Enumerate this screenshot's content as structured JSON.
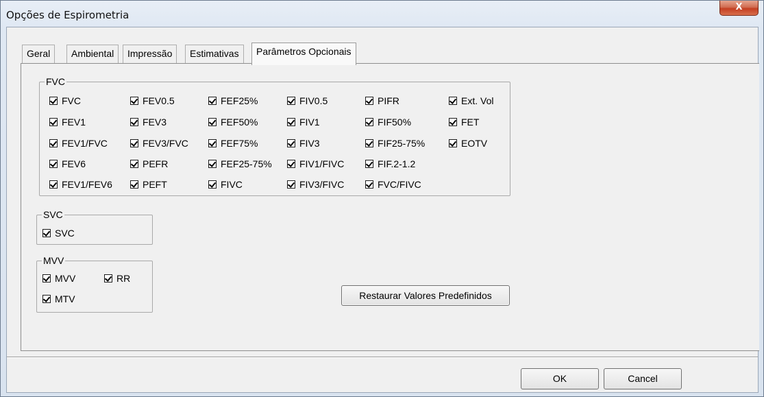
{
  "window": {
    "title": "Opções de Espirometria",
    "close_glyph": "X"
  },
  "tabs": [
    {
      "label": "Geral"
    },
    {
      "label": "Ambiental"
    },
    {
      "label": "Impressão"
    },
    {
      "label": "Estimativas"
    },
    {
      "label": "Parâmetros Opcionais",
      "active": true
    }
  ],
  "groups": {
    "fvc": {
      "title": "FVC",
      "items": [
        {
          "label": "FVC",
          "checked": true
        },
        {
          "label": "FEV1",
          "checked": true
        },
        {
          "label": "FEV1/FVC",
          "checked": true
        },
        {
          "label": "FEV6",
          "checked": true
        },
        {
          "label": "FEV1/FEV6",
          "checked": true
        },
        {
          "label": "FEV0.5",
          "checked": true
        },
        {
          "label": "FEV3",
          "checked": true
        },
        {
          "label": "FEV3/FVC",
          "checked": true
        },
        {
          "label": "PEFR",
          "checked": true
        },
        {
          "label": "PEFT",
          "checked": true
        },
        {
          "label": "FEF25%",
          "checked": true
        },
        {
          "label": "FEF50%",
          "checked": true
        },
        {
          "label": "FEF75%",
          "checked": true
        },
        {
          "label": "FEF25-75%",
          "checked": true
        },
        {
          "label": "FIVC",
          "checked": true
        },
        {
          "label": "FIV0.5",
          "checked": true
        },
        {
          "label": "FIV1",
          "checked": true
        },
        {
          "label": "FIV3",
          "checked": true
        },
        {
          "label": "FIV1/FIVC",
          "checked": true
        },
        {
          "label": "FIV3/FIVC",
          "checked": true
        },
        {
          "label": "PIFR",
          "checked": true
        },
        {
          "label": "FIF50%",
          "checked": true
        },
        {
          "label": "FIF25-75%",
          "checked": true
        },
        {
          "label": "FIF.2-1.2",
          "checked": true
        },
        {
          "label": "FVC/FIVC",
          "checked": true
        },
        {
          "label": "Ext. Vol",
          "checked": true
        },
        {
          "label": "FET",
          "checked": true
        },
        {
          "label": "EOTV",
          "checked": true
        }
      ]
    },
    "svc": {
      "title": "SVC",
      "items": [
        {
          "label": "SVC",
          "checked": true
        }
      ]
    },
    "mvv": {
      "title": "MVV",
      "items": [
        {
          "label": "MVV",
          "checked": true
        },
        {
          "label": "RR",
          "checked": true
        },
        {
          "label": "MTV",
          "checked": true
        }
      ]
    }
  },
  "buttons": {
    "restore": "Restaurar Valores Predefinidos",
    "ok": "OK",
    "cancel": "Cancel"
  }
}
